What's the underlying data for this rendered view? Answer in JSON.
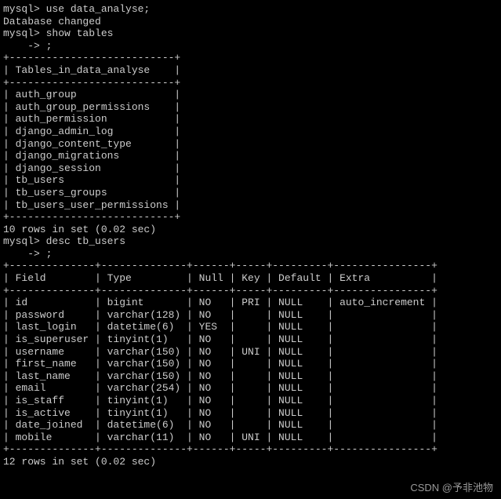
{
  "prompt": "mysql>",
  "cont": "    ->",
  "cmd_use": "use data_analyse;",
  "resp_use": "Database changed",
  "cmd_show": "show tables",
  "semi": ";",
  "tables_header": "Tables_in_data_analyse",
  "tables": [
    "auth_group",
    "auth_group_permissions",
    "auth_permission",
    "django_admin_log",
    "django_content_type",
    "django_migrations",
    "django_session",
    "tb_users",
    "tb_users_groups",
    "tb_users_user_permissions"
  ],
  "tables_summary": "10 rows in set (0.02 sec)",
  "cmd_desc": "desc tb_users",
  "desc_headers": [
    "Field",
    "Type",
    "Null",
    "Key",
    "Default",
    "Extra"
  ],
  "desc_rows": [
    [
      "id",
      "bigint",
      "NO",
      "PRI",
      "NULL",
      "auto_increment"
    ],
    [
      "password",
      "varchar(128)",
      "NO",
      "",
      "NULL",
      ""
    ],
    [
      "last_login",
      "datetime(6)",
      "YES",
      "",
      "NULL",
      ""
    ],
    [
      "is_superuser",
      "tinyint(1)",
      "NO",
      "",
      "NULL",
      ""
    ],
    [
      "username",
      "varchar(150)",
      "NO",
      "UNI",
      "NULL",
      ""
    ],
    [
      "first_name",
      "varchar(150)",
      "NO",
      "",
      "NULL",
      ""
    ],
    [
      "last_name",
      "varchar(150)",
      "NO",
      "",
      "NULL",
      ""
    ],
    [
      "email",
      "varchar(254)",
      "NO",
      "",
      "NULL",
      ""
    ],
    [
      "is_staff",
      "tinyint(1)",
      "NO",
      "",
      "NULL",
      ""
    ],
    [
      "is_active",
      "tinyint(1)",
      "NO",
      "",
      "NULL",
      ""
    ],
    [
      "date_joined",
      "datetime(6)",
      "NO",
      "",
      "NULL",
      ""
    ],
    [
      "mobile",
      "varchar(11)",
      "NO",
      "UNI",
      "NULL",
      ""
    ]
  ],
  "desc_summary": "12 rows in set (0.02 sec)",
  "watermark": "CSDN @予非池物",
  "widths": {
    "tables_col": 27,
    "desc_cols": [
      14,
      14,
      6,
      5,
      9,
      16
    ]
  }
}
